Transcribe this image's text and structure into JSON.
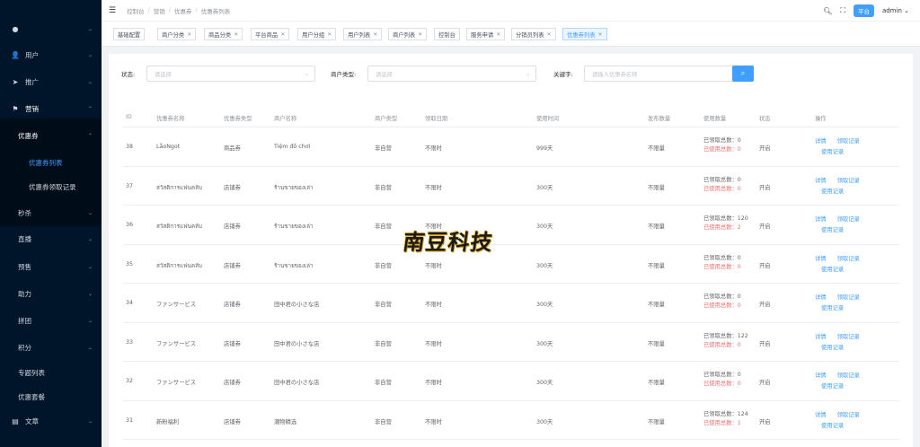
{
  "sidebar": {
    "items": [
      {
        "label": "",
        "icon": "user-icon",
        "chevron": true
      },
      {
        "label": "用户",
        "icon": "user-icon",
        "chevron": true
      },
      {
        "label": "推广",
        "icon": "send-icon",
        "chevron": true
      },
      {
        "label": "营销",
        "icon": "flag-icon",
        "chevron": true
      },
      {
        "label": "优惠券",
        "icon": "",
        "chevron": true
      },
      {
        "label": "优惠券列表",
        "icon": "",
        "chevron": false
      },
      {
        "label": "优惠券领取记录",
        "icon": "",
        "chevron": false
      },
      {
        "label": "秒杀",
        "icon": "",
        "chevron": true
      },
      {
        "label": "直播",
        "icon": "",
        "chevron": true
      },
      {
        "label": "预售",
        "icon": "",
        "chevron": true
      },
      {
        "label": "助力",
        "icon": "",
        "chevron": true
      },
      {
        "label": "拼团",
        "icon": "",
        "chevron": true
      },
      {
        "label": "积分",
        "icon": "",
        "chevron": true
      },
      {
        "label": "专题列表",
        "icon": "",
        "chevron": false
      },
      {
        "label": "优惠套餐",
        "icon": "",
        "chevron": false
      },
      {
        "label": "文章",
        "icon": "article-icon",
        "chevron": true
      }
    ]
  },
  "header": {
    "breadcrumb": [
      "控制台",
      "营销",
      "优惠券",
      "优惠券列表"
    ],
    "platform_badge": "平台",
    "user": "admin"
  },
  "tags": [
    {
      "label": "基础配置"
    },
    {
      "label": "商户分类"
    },
    {
      "label": "商品分类"
    },
    {
      "label": "平台商品"
    },
    {
      "label": "用户分组"
    },
    {
      "label": "用户列表"
    },
    {
      "label": "商户列表"
    },
    {
      "label": "控制台"
    },
    {
      "label": "服务申请"
    },
    {
      "label": "分销员列表"
    },
    {
      "label": "优惠券列表"
    }
  ],
  "filter": {
    "status_label": "状态:",
    "status_placeholder": "请选择",
    "merchant_type_label": "商户类型:",
    "merchant_type_placeholder": "请选择",
    "keyword_label": "关键字:",
    "keyword_placeholder": "请输入优惠券名称"
  },
  "table": {
    "headers": [
      "ID",
      "优惠券名称",
      "优惠券类型",
      "商户名称",
      "商户类型",
      "领取日期",
      "使用时间",
      "发布数量",
      "使用数量",
      "状态",
      "操作"
    ],
    "rows": [
      {
        "id": "38",
        "name": "LẫoNgot",
        "type": "商品券",
        "merchant": "Tiệm đồ chơi",
        "mtype": "非自营",
        "date": "不限时",
        "use": "999天",
        "qty": "不限量",
        "received": "已领取总数：0",
        "used": "已使用总数：0",
        "status": "开启"
      },
      {
        "id": "37",
        "name": "สวัสดิการแฟนคลับ",
        "type": "店铺券",
        "merchant": "ร้านขายของเล่า",
        "mtype": "非自营",
        "date": "不限时",
        "use": "300天",
        "qty": "不限量",
        "received": "已领取总数：0",
        "used": "已使用总数：0",
        "status": "开启"
      },
      {
        "id": "36",
        "name": "สวัสดิการแฟนคลับ",
        "type": "店铺券",
        "merchant": "ร้านขายของเล่า",
        "mtype": "非自营",
        "date": "不限时",
        "use": "300天",
        "qty": "不限量",
        "received": "已领取总数：120",
        "used": "已使用总数：2",
        "status": "开启"
      },
      {
        "id": "35",
        "name": "สวัสดิการแฟนคลับ",
        "type": "店铺券",
        "merchant": "ร้านขายของเล่า",
        "mtype": "非自营",
        "date": "不限时",
        "use": "300天",
        "qty": "不限量",
        "received": "已领取总数：0",
        "used": "已使用总数：0",
        "status": "开启"
      },
      {
        "id": "34",
        "name": "ファンサービス",
        "type": "店铺券",
        "merchant": "田中君の小さな店",
        "mtype": "非自营",
        "date": "不限时",
        "use": "300天",
        "qty": "不限量",
        "received": "已领取总数：0",
        "used": "已使用总数：0",
        "status": "开启"
      },
      {
        "id": "33",
        "name": "ファンサービス",
        "type": "店铺券",
        "merchant": "田中君の小さな店",
        "mtype": "非自营",
        "date": "不限时",
        "use": "300天",
        "qty": "不限量",
        "received": "已领取总数：122",
        "used": "已使用总数：0",
        "status": "开启"
      },
      {
        "id": "32",
        "name": "ファンサービス",
        "type": "店铺券",
        "merchant": "田中君の小さな店",
        "mtype": "非自营",
        "date": "不限时",
        "use": "300天",
        "qty": "不限量",
        "received": "已领取总数：0",
        "used": "已使用总数：0",
        "status": "开启"
      },
      {
        "id": "31",
        "name": "新粉福利",
        "type": "店铺券",
        "merchant": "潮物精选",
        "mtype": "非自营",
        "date": "不限时",
        "use": "300天",
        "qty": "不限量",
        "received": "已领取总数：124",
        "used": "已使用总数：1",
        "status": "开启"
      }
    ],
    "op_detail": "详情",
    "op_receive": "领取记录",
    "op_use": "使用记录"
  },
  "watermark": "南豆科技",
  "colors": {
    "accent": "#409eff",
    "sidebar_bg": "#001529",
    "danger": "#f56c6c"
  }
}
